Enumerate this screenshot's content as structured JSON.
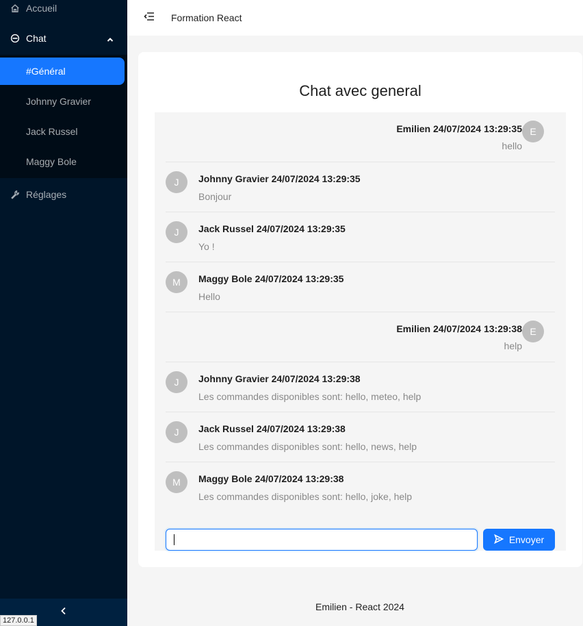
{
  "sidebar": {
    "home_label": "Accueil",
    "chat_label": "Chat",
    "channels": [
      {
        "label": "#Général"
      },
      {
        "label": "Johnny Gravier"
      },
      {
        "label": "Jack Russel"
      },
      {
        "label": "Maggy Bole"
      }
    ],
    "settings_label": "Réglages"
  },
  "status_url": "127.0.0.1",
  "header": {
    "title": "Formation React"
  },
  "chat": {
    "title": "Chat avec general",
    "messages": [
      {
        "initial": "E",
        "meta": "Emilien 24/07/2024 13:29:35",
        "text": "hello"
      },
      {
        "initial": "J",
        "meta": "Johnny Gravier 24/07/2024 13:29:35",
        "text": "Bonjour"
      },
      {
        "initial": "J",
        "meta": "Jack Russel 24/07/2024 13:29:35",
        "text": "Yo !"
      },
      {
        "initial": "M",
        "meta": "Maggy Bole 24/07/2024 13:29:35",
        "text": "Hello"
      },
      {
        "initial": "E",
        "meta": "Emilien 24/07/2024 13:29:38",
        "text": "help"
      },
      {
        "initial": "J",
        "meta": "Johnny Gravier 24/07/2024 13:29:38",
        "text": "Les commandes disponibles sont: hello, meteo, help"
      },
      {
        "initial": "J",
        "meta": "Jack Russel 24/07/2024 13:29:38",
        "text": "Les commandes disponibles sont: hello, news, help"
      },
      {
        "initial": "M",
        "meta": "Maggy Bole 24/07/2024 13:29:38",
        "text": "Les commandes disponibles sont: hello, joke, help"
      }
    ],
    "input_value": "",
    "send_label": "Envoyer"
  },
  "footer": {
    "text": "Emilien - React 2024"
  },
  "colors": {
    "sider": "#001529",
    "submenu": "#000c17",
    "accent": "#1677ff"
  }
}
